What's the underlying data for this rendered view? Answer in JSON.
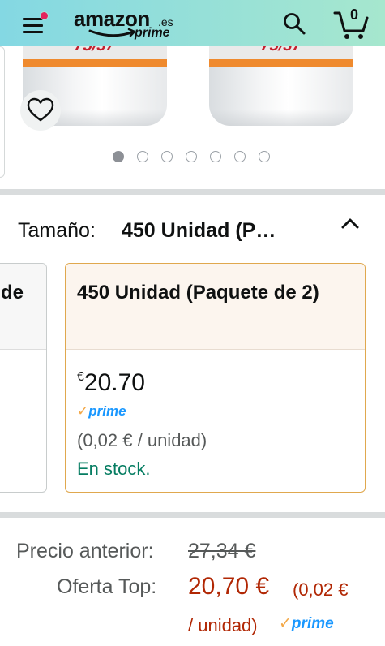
{
  "header": {
    "logo_brand": "amazon",
    "logo_tld": ".es",
    "logo_program": "prime",
    "cart_count": "0",
    "icons": {
      "menu": "hamburger-menu-icon",
      "search": "search-icon",
      "cart": "cart-icon",
      "notification": "notification-dot"
    },
    "colors": {
      "gradient_start": "#84d8e3",
      "gradient_end": "#a6e7ce",
      "notification": "#e4245b"
    }
  },
  "carousel": {
    "product_label_text": "75/37",
    "total_images": 7,
    "active_index": 0,
    "favorite_icon": "heart-icon"
  },
  "size_selector": {
    "label": "Tamaño:",
    "selected_value": "450 Unidad (P…",
    "collapse_icon": "chevron-up-icon",
    "previous_option_fragment": "de",
    "selected_option": {
      "name": "450 Unidad (Paquete de 2)",
      "currency_symbol": "€",
      "price": "20.70",
      "prime_check": "✓",
      "prime_word": "prime",
      "unit_price": "(0,02 € / unidad)",
      "stock": "En stock."
    }
  },
  "pricing": {
    "previous_label": "Precio anterior:",
    "previous_price": "27,34 €",
    "deal_label": "Oferta Top:",
    "deal_price": "20,70 €",
    "deal_unit_part1": "(0,02 €",
    "deal_unit_part2": "/ unidad)",
    "prime_check": "✓",
    "prime_word": "prime",
    "colors": {
      "deal": "#b12704",
      "stock": "#067d62",
      "prime_blue": "#1a98ff",
      "prime_check": "#f3a847",
      "selected_border": "#e0a84e"
    }
  }
}
